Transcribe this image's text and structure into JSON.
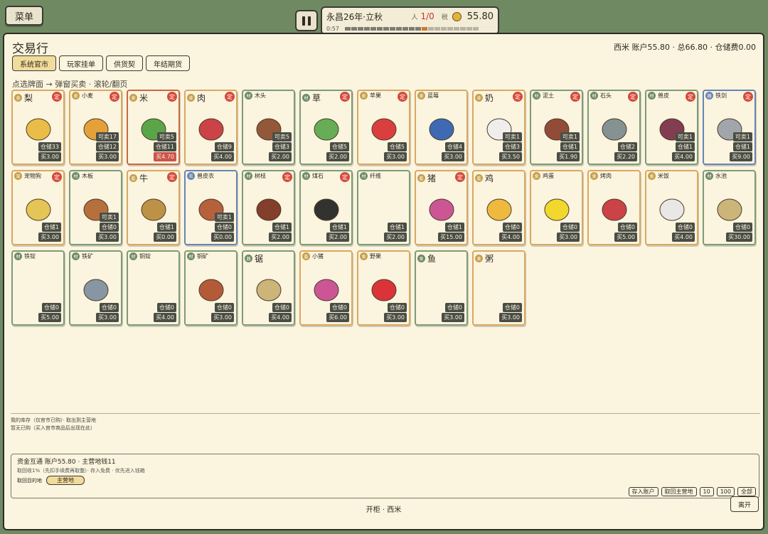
{
  "menu": {
    "label": "菜单"
  },
  "status": {
    "date": "永昌26年·立秋",
    "pop_label": "人",
    "pop": "1/0",
    "tax_label": "税",
    "money": "55.80",
    "time": "0:57"
  },
  "panel": {
    "title": "交易行",
    "account": "西米  账户55.80 · 总66.80 · 仓储费0.00",
    "hint": "点选牌面 → 弹窗买卖 · 滚轮/翻页",
    "tabs": [
      {
        "label": "系统官市"
      },
      {
        "label": "玩家挂单"
      },
      {
        "label": "供货契"
      },
      {
        "label": "年结期货"
      }
    ]
  },
  "items": [
    {
      "name": "梨",
      "big": true,
      "border": "orange",
      "badge": "食",
      "fixed": "定",
      "sell": "",
      "stock": "仓储33",
      "buy": "买3.00",
      "icon": "pear-icon",
      "color": "#e9b93c"
    },
    {
      "name": "小麦",
      "big": false,
      "border": "orange",
      "badge": "食",
      "fixed": "定",
      "sell": "可卖17",
      "stock": "仓储12",
      "buy": "买3.00",
      "icon": "wheat-icon",
      "color": "#e39a2b"
    },
    {
      "name": "米",
      "big": true,
      "border": "red",
      "badge": "食",
      "fixed": "定",
      "sell": "可卖5",
      "stock": "仓储11",
      "buy": "买4.70",
      "buy_red": true,
      "icon": "rice-icon",
      "color": "#4e9f3d"
    },
    {
      "name": "肉",
      "big": true,
      "border": "orange",
      "badge": "食",
      "fixed": "定",
      "sell": "",
      "stock": "仓储9",
      "buy": "买4.00",
      "icon": "meat-icon",
      "color": "#c8343a"
    },
    {
      "name": "木头",
      "big": false,
      "border": "green",
      "badge": "材",
      "fixed": "",
      "sell": "可卖5",
      "stock": "仓储3",
      "buy": "买2.00",
      "icon": "wood-icon",
      "color": "#8b4a2b"
    },
    {
      "name": "草",
      "big": true,
      "border": "green",
      "badge": "材",
      "fixed": "定",
      "sell": "",
      "stock": "仓储5",
      "buy": "买2.00",
      "icon": "grass-icon",
      "color": "#5aa84a"
    },
    {
      "name": "苹果",
      "big": false,
      "border": "orange",
      "badge": "食",
      "fixed": "定",
      "sell": "",
      "stock": "仓储5",
      "buy": "买3.00",
      "icon": "apple-icon",
      "color": "#d83030"
    },
    {
      "name": "蓝莓",
      "big": false,
      "border": "orange",
      "badge": "食",
      "fixed": "",
      "sell": "",
      "stock": "仓储4",
      "buy": "买3.00",
      "icon": "blueberry-icon",
      "color": "#2f5fb0"
    },
    {
      "name": "奶",
      "big": true,
      "border": "orange",
      "badge": "食",
      "fixed": "定",
      "sell": "可卖1",
      "stock": "仓储3",
      "buy": "买3.50",
      "icon": "milk-icon",
      "color": "#eeeeee"
    },
    {
      "name": "泥土",
      "big": false,
      "border": "green",
      "badge": "材",
      "fixed": "定",
      "sell": "可卖1",
      "stock": "仓储1",
      "buy": "买1.90",
      "icon": "dirt-icon",
      "color": "#8a3d28"
    },
    {
      "name": "石头",
      "big": false,
      "border": "green",
      "badge": "材",
      "fixed": "定",
      "sell": "",
      "stock": "仓储2",
      "buy": "买2.20",
      "icon": "stone-icon",
      "color": "#7b8a8c"
    },
    {
      "name": "兽皮",
      "big": false,
      "border": "green",
      "badge": "材",
      "fixed": "定",
      "sell": "可卖1",
      "stock": "仓储1",
      "buy": "买4.00",
      "icon": "hide-icon",
      "color": "#7a2e44"
    },
    {
      "name": "铁剑",
      "big": false,
      "border": "blue",
      "badge": "器",
      "fixed": "定",
      "sell": "可卖1",
      "stock": "仓储1",
      "buy": "买9.00",
      "icon": "sword-icon",
      "color": "#9aa0a6"
    },
    {
      "name": "宠物狗",
      "big": false,
      "border": "orange",
      "badge": "宠",
      "fixed": "定",
      "sell": "",
      "stock": "仓储1",
      "buy": "买3.00",
      "icon": "dog-icon",
      "color": "#e3c24a"
    },
    {
      "name": "木板",
      "big": false,
      "border": "green",
      "badge": "材",
      "fixed": "",
      "sell": "可卖1",
      "stock": "仓储0",
      "buy": "买3.00",
      "icon": "plank-icon",
      "color": "#b0652e"
    },
    {
      "name": "牛",
      "big": true,
      "border": "orange",
      "badge": "畜",
      "fixed": "定",
      "sell": "",
      "stock": "仓储1",
      "buy": "买0.00",
      "icon": "cow-icon",
      "color": "#b98a3a"
    },
    {
      "name": "兽皮衣",
      "big": false,
      "border": "blue",
      "badge": "衣",
      "fixed": "",
      "sell": "可卖1",
      "stock": "仓储0",
      "buy": "买0.00",
      "icon": "leather-coat-icon",
      "color": "#b0552e"
    },
    {
      "name": "树枝",
      "big": false,
      "border": "green",
      "badge": "材",
      "fixed": "定",
      "sell": "",
      "stock": "仓储1",
      "buy": "买2.00",
      "icon": "branch-icon",
      "color": "#7a2f1d"
    },
    {
      "name": "煤石",
      "big": false,
      "border": "green",
      "badge": "材",
      "fixed": "定",
      "sell": "",
      "stock": "仓储1",
      "buy": "买2.00",
      "icon": "coal-icon",
      "color": "#222222"
    },
    {
      "name": "纤维",
      "big": false,
      "border": "green",
      "badge": "材",
      "fixed": "",
      "sell": "",
      "stock": "仓储1",
      "buy": "买2.00",
      "icon": "fiber-icon",
      "color": ""
    },
    {
      "name": "猪",
      "big": true,
      "border": "orange",
      "badge": "畜",
      "fixed": "定",
      "sell": "",
      "stock": "仓储1",
      "buy": "买15.00",
      "icon": "pig-icon",
      "color": "#c9498f"
    },
    {
      "name": "鸡",
      "big": true,
      "border": "orange",
      "badge": "畜",
      "fixed": "",
      "sell": "",
      "stock": "仓储0",
      "buy": "买4.00",
      "icon": "chicken-icon",
      "color": "#efb530"
    },
    {
      "name": "鸡蛋",
      "big": false,
      "border": "orange",
      "badge": "食",
      "fixed": "",
      "sell": "",
      "stock": "仓储0",
      "buy": "买3.00",
      "icon": "egg-icon",
      "color": "#f2d61e"
    },
    {
      "name": "烤肉",
      "big": false,
      "border": "orange",
      "badge": "食",
      "fixed": "",
      "sell": "",
      "stock": "仓储0",
      "buy": "买5.00",
      "icon": "kebab-icon",
      "color": "#c8343a"
    },
    {
      "name": "米饭",
      "big": false,
      "border": "orange",
      "badge": "食",
      "fixed": "",
      "sell": "",
      "stock": "仓储0",
      "buy": "买4.00",
      "icon": "rice-bowl-icon",
      "color": "#e8e8e8"
    },
    {
      "name": "水池",
      "big": false,
      "border": "green",
      "badge": "材",
      "fixed": "",
      "sell": "",
      "stock": "仓储0",
      "buy": "买30.00",
      "icon": "pool-icon",
      "color": "#c8b070"
    },
    {
      "name": "铁锭",
      "big": false,
      "border": "green",
      "badge": "材",
      "fixed": "",
      "sell": "",
      "stock": "仓储0",
      "buy": "买5.00",
      "icon": "iron-ingot-icon",
      "color": ""
    },
    {
      "name": "铁矿",
      "big": false,
      "border": "green",
      "badge": "材",
      "fixed": "",
      "sell": "",
      "stock": "仓储0",
      "buy": "买3.00",
      "icon": "iron-ore-icon",
      "color": "#7f8fa0"
    },
    {
      "name": "铜锭",
      "big": false,
      "border": "green",
      "badge": "材",
      "fixed": "",
      "sell": "",
      "stock": "仓储0",
      "buy": "买4.00",
      "icon": "copper-ingot-icon",
      "color": ""
    },
    {
      "name": "铜矿",
      "big": false,
      "border": "green",
      "badge": "材",
      "fixed": "",
      "sell": "",
      "stock": "仓储0",
      "buy": "买3.00",
      "icon": "copper-ore-icon",
      "color": "#b04e2a"
    },
    {
      "name": "锯",
      "big": true,
      "border": "green",
      "badge": "器",
      "fixed": "",
      "sell": "",
      "stock": "仓储0",
      "buy": "买4.00",
      "icon": "saw-icon",
      "color": "#c8b070"
    },
    {
      "name": "小猪",
      "big": false,
      "border": "orange",
      "badge": "畜",
      "fixed": "",
      "sell": "",
      "stock": "仓储0",
      "buy": "买6.00",
      "icon": "piglet-icon",
      "color": "#c9498f"
    },
    {
      "name": "野果",
      "big": false,
      "border": "orange",
      "badge": "食",
      "fixed": "",
      "sell": "",
      "stock": "仓储0",
      "buy": "买3.00",
      "icon": "cherry-icon",
      "color": "#d8242c"
    },
    {
      "name": "鱼",
      "big": true,
      "border": "green",
      "badge": "食",
      "fixed": "",
      "sell": "",
      "stock": "仓储0",
      "buy": "买3.00",
      "icon": "fish-icon",
      "color": ""
    },
    {
      "name": "粥",
      "big": true,
      "border": "orange",
      "badge": "食",
      "fixed": "",
      "sell": "",
      "stock": "仓储0",
      "buy": "买3.00",
      "icon": "porridge-icon",
      "color": ""
    }
  ],
  "inventory": {
    "line1": "我的库存（仅官市已购）· 取出到主营地",
    "line2": "暂无已购（买入官市商品后出现在此）"
  },
  "transfer": {
    "line1": "资金互通  账户55.80 · 主营地钱11",
    "line2": "取回收1%（先扣手续费再取整）· 存入免费 · 优先进入钱箱",
    "dest_label": "取回目的地",
    "dest": "主营地",
    "actions": [
      {
        "label": "存入账户"
      },
      {
        "label": "取回主营地"
      },
      {
        "label": "10"
      },
      {
        "label": "100"
      },
      {
        "label": "全部"
      }
    ]
  },
  "footer": {
    "text": "开柜 · 西米",
    "leave": "离开"
  }
}
